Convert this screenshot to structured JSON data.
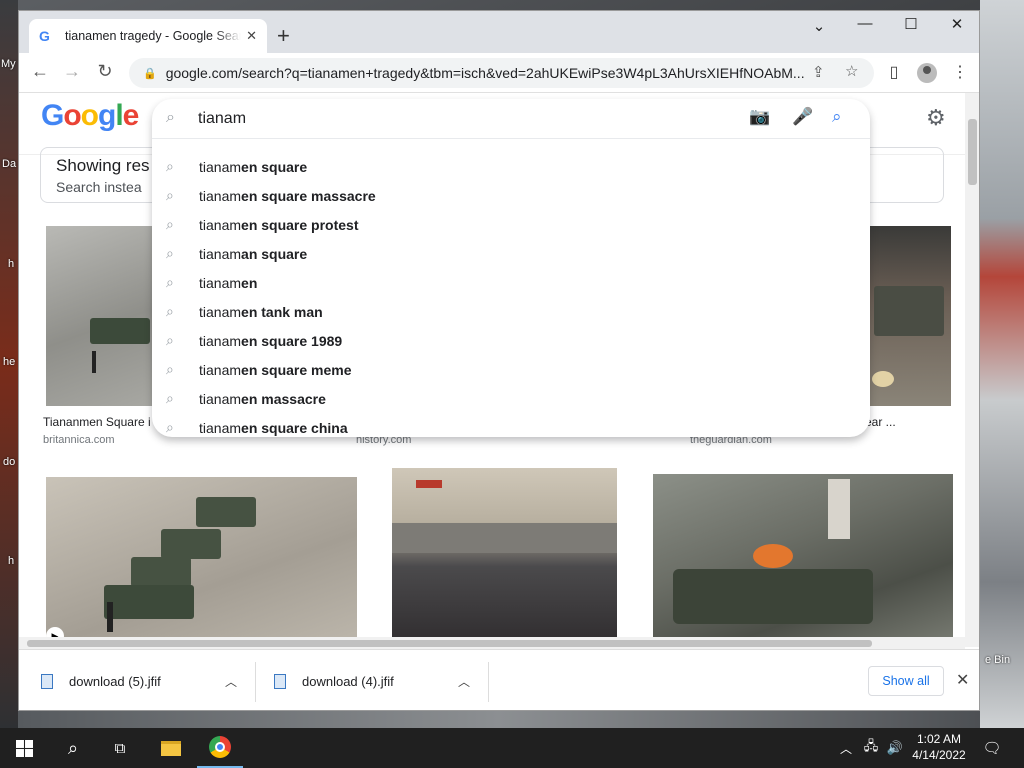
{
  "desktop": {
    "labels": [
      "My",
      "Da",
      "h",
      "he",
      "do",
      "h",
      "e Bin"
    ]
  },
  "browser": {
    "tab_title": "tianamen tragedy - Google Search",
    "tab_favicon": "G",
    "new_tab": "+",
    "url": "google.com/search?q=tianamen+tragedy&tbm=isch&ved=2ahUKEwiPse3W4pL3AhUrsXIEHfNOAbM...",
    "window_controls": [
      "chevron-down-icon",
      "minimize-icon",
      "maximize-icon",
      "close-icon"
    ]
  },
  "google": {
    "logo": [
      "G",
      "o",
      "o",
      "g",
      "l",
      "e"
    ],
    "logo_colors": [
      "#4285f4",
      "#ea4335",
      "#fbbc05",
      "#4285f4",
      "#34a853",
      "#ea4335"
    ],
    "search_value": "tianam",
    "showing_text": "Showing res",
    "search_instead": "Search instea",
    "suggestions": [
      {
        "prefix": "tianam",
        "rest": "en square"
      },
      {
        "prefix": "tianam",
        "rest": "en square massacre"
      },
      {
        "prefix": "tianam",
        "rest": "en square protest"
      },
      {
        "prefix": "tianam",
        "rest": "an square"
      },
      {
        "prefix": "tianam",
        "rest": "en"
      },
      {
        "prefix": "tianam",
        "rest": "en tank man"
      },
      {
        "prefix": "tianam",
        "rest": "en square 1989"
      },
      {
        "prefix": "tianam",
        "rest": "en square meme"
      },
      {
        "prefix": "tianam",
        "rest": "en massacre"
      },
      {
        "prefix": "tianam",
        "rest": "en square china"
      }
    ],
    "results": [
      {
        "caption": "Tiananmen Square i",
        "source": "britannica.com"
      },
      {
        "caption": "",
        "source": "history.com"
      },
      {
        "caption": "ear ...",
        "source": "theguardian.com"
      }
    ]
  },
  "downloads": {
    "items": [
      "download (5).jfif",
      "download (4).jfif"
    ],
    "show_all": "Show all"
  },
  "taskbar": {
    "time": "1:02 AM",
    "date": "4/14/2022"
  }
}
